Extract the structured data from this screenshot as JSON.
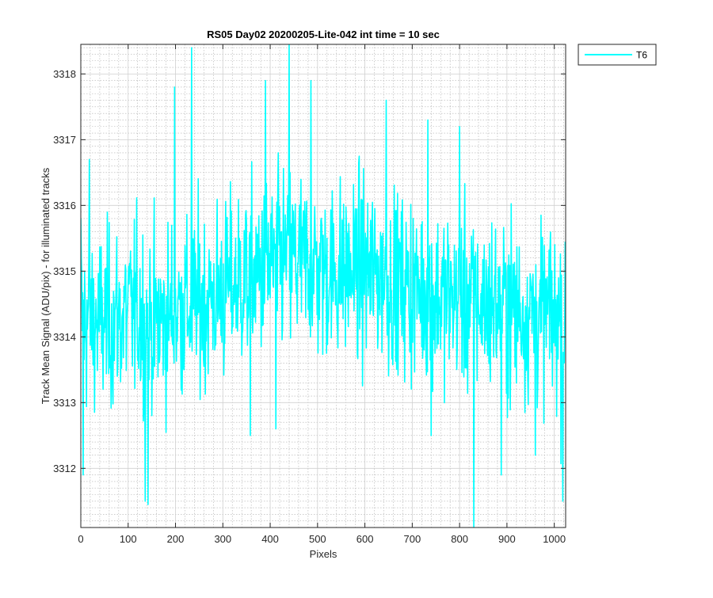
{
  "chart_data": {
    "type": "line",
    "title": "RS05 Day02 20200205-Lite-042 int time = 10 sec",
    "xlabel": "Pixels",
    "ylabel": "Track Mean Signal (ADU/pix) - for illuminated tracks",
    "xlim": [
      0,
      1024
    ],
    "ylim": [
      3311.1,
      3318.45
    ],
    "xticks": [
      0,
      100,
      200,
      300,
      400,
      500,
      600,
      700,
      800,
      900,
      1000
    ],
    "yticks": [
      3312,
      3313,
      3314,
      3315,
      3316,
      3317,
      3318
    ],
    "grid": "major and minor",
    "legend_position": "outside top-right",
    "series": [
      {
        "name": "T6",
        "color": "#00ffff",
        "profile_x": [
          0,
          40,
          80,
          120,
          160,
          200,
          240,
          280,
          320,
          360,
          400,
          440,
          480,
          520,
          560,
          600,
          640,
          680,
          720,
          760,
          800,
          840,
          880,
          920,
          960,
          1000,
          1023
        ],
        "profile_mean": [
          3314.3,
          3314.2,
          3314.3,
          3314.4,
          3314.2,
          3314.4,
          3314.5,
          3314.6,
          3314.8,
          3314.9,
          3315.1,
          3315.2,
          3315.1,
          3315.0,
          3315.0,
          3315.0,
          3314.9,
          3314.8,
          3314.7,
          3314.6,
          3314.6,
          3314.5,
          3314.5,
          3314.4,
          3314.4,
          3314.3,
          3314.2
        ],
        "noise_amplitude": 0.95,
        "spikes": [
          {
            "x": 0,
            "y": 3315.8
          },
          {
            "x": 5,
            "y": 3311.9
          },
          {
            "x": 18,
            "y": 3316.7
          },
          {
            "x": 136,
            "y": 3311.5
          },
          {
            "x": 142,
            "y": 3311.45
          },
          {
            "x": 198,
            "y": 3317.8
          },
          {
            "x": 234,
            "y": 3318.4
          },
          {
            "x": 358,
            "y": 3312.5
          },
          {
            "x": 390,
            "y": 3317.9
          },
          {
            "x": 412,
            "y": 3312.6
          },
          {
            "x": 440,
            "y": 3318.45
          },
          {
            "x": 486,
            "y": 3317.9
          },
          {
            "x": 645,
            "y": 3317.6
          },
          {
            "x": 733,
            "y": 3317.3
          },
          {
            "x": 740,
            "y": 3312.5
          },
          {
            "x": 800,
            "y": 3317.2
          },
          {
            "x": 830,
            "y": 3311.1
          },
          {
            "x": 888,
            "y": 3311.9
          },
          {
            "x": 960,
            "y": 3312.2
          },
          {
            "x": 1018,
            "y": 3311.5
          }
        ]
      }
    ]
  }
}
